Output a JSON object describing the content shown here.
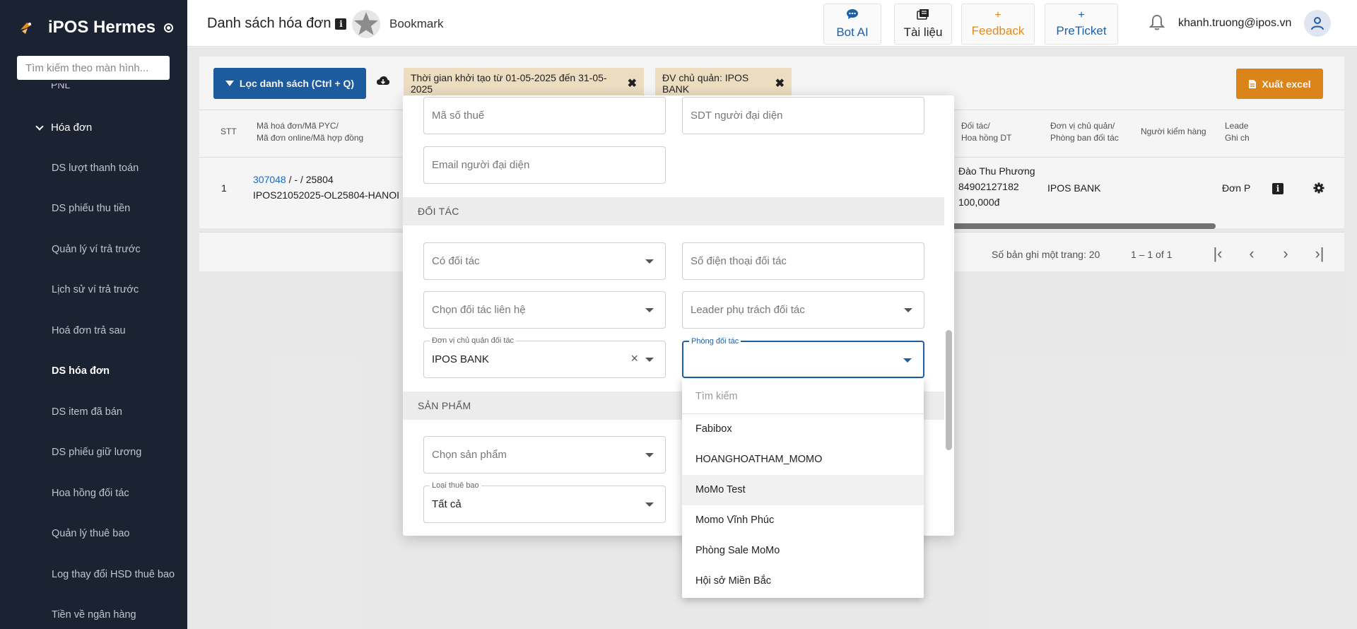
{
  "sidebar": {
    "brand": "iPOS Hermes",
    "search_placeholder": "Tìm kiếm theo màn hình...",
    "cut_item": "PNL",
    "group": "Hóa đơn",
    "items": [
      {
        "label": "DS lượt thanh toán"
      },
      {
        "label": "DS phiếu thu tiền"
      },
      {
        "label": "Quản lý ví trả trước"
      },
      {
        "label": "Lịch sử ví trả trước"
      },
      {
        "label": "Hoá đơn trả sau"
      },
      {
        "label": "DS hóa đơn"
      },
      {
        "label": "DS item đã bán"
      },
      {
        "label": "DS phiếu giữ lương"
      },
      {
        "label": "Hoa hồng đối tác"
      },
      {
        "label": "Quản lý thuê bao"
      },
      {
        "label": "Log thay đổi HSD thuê bao"
      },
      {
        "label": "Tiền về ngân hàng"
      }
    ]
  },
  "header": {
    "title": "Danh sách hóa đơn",
    "bookmark": "Bookmark",
    "buttons": {
      "bot_ai": "Bot AI",
      "docs": "Tài liệu",
      "feedback": "Feedback",
      "preticket": "PreTicket"
    },
    "user_email": "khanh.truong@ipos.vn"
  },
  "toolbar": {
    "filter_label": "Lọc danh sách (Ctrl + Q)",
    "chip_time": "Thời gian khởi tạo từ 01-05-2025 đến 31-05-2025",
    "chip_unit": "ĐV chủ quản: IPOS BANK",
    "export_label": "Xuất excel"
  },
  "table": {
    "headers": {
      "stt": "STT",
      "code_1": "Mã hoá đơn/Mã PYC/",
      "code_2": "Mã đơn online/Mã hợp đồng",
      "partner_1": "Đối tác/",
      "partner_2": "Hoa hồng DT",
      "unit_1": "Đơn vị chủ quản/",
      "unit_2": "Phòng ban đối tác",
      "checker": "Người kiểm hàng",
      "leader_1": "Leade",
      "leader_2": "Ghi ch"
    },
    "row": {
      "stt": "1",
      "invoice_link": "307048",
      "invoice_rest": " / - / 25804",
      "order_code": "IPOS21052025-OL25804-HANOI",
      "partner_name": "Đào Thu Phương",
      "partner_phone": "84902127182",
      "commission": "100,000đ",
      "unit": "IPOS BANK",
      "leader": "Đơn P"
    }
  },
  "pager": {
    "rows_per_page": "Số bản ghi một trang: 20",
    "range": "1 – 1 of 1"
  },
  "modal": {
    "tax_code": "Mã số thuế",
    "rep_phone": "SDT người đại diện",
    "rep_email": "Email người đại diện",
    "section_partner": "ĐỐI TÁC",
    "has_partner": "Có đối tác",
    "partner_phone": "Số điện thoại đối tác",
    "choose_contact": "Chọn đối tác liên hệ",
    "leader": "Leader phụ trách đối tác",
    "unit_label": "Đơn vị chủ quản đối tác",
    "unit_value": "IPOS BANK",
    "dept_label": "Phòng đối tác",
    "section_product": "SẢN PHẨM",
    "choose_product": "Chọn sản phẩm",
    "sub_type_label": "Loại thuê bao",
    "sub_type_value": "Tất cả"
  },
  "dropdown": {
    "search_placeholder": "Tìm kiếm",
    "options": [
      "Fabibox",
      "HOANGHOATHAM_MOMO",
      "MoMo Test",
      "Momo Vĩnh Phúc",
      "Phòng Sale MoMo",
      "Hội sở Miền Bắc"
    ],
    "hovered": "MoMo Test"
  },
  "colors": {
    "sidebar_bg": "#1b2232",
    "primary": "#1f5fa6",
    "accent_orange": "#e38a1c",
    "chip_bg": "#f6e7c9"
  }
}
